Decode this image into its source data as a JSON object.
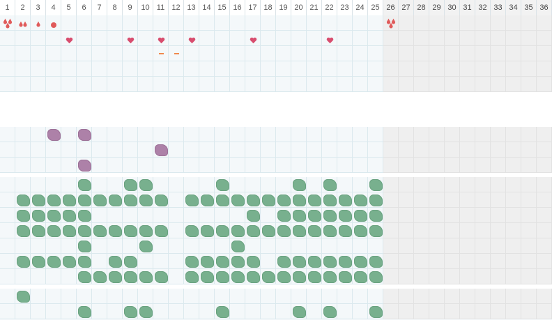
{
  "days": [
    "1",
    "2",
    "3",
    "4",
    "5",
    "6",
    "7",
    "8",
    "9",
    "10",
    "11",
    "12",
    "13",
    "14",
    "15",
    "16",
    "17",
    "18",
    "19",
    "20",
    "21",
    "22",
    "23",
    "24",
    "25",
    "26",
    "27",
    "28",
    "29",
    "30",
    "31",
    "32",
    "33",
    "34",
    "35",
    "36"
  ],
  "today_index": 25,
  "colors": {
    "background": "#f4f8fa",
    "future_background": "#efefef",
    "grid_line": "#dbe9ee",
    "drop_red": "#e05a5a",
    "heart_pink": "#d84d6e",
    "dash_orange": "#f0884e",
    "green_symptom": "#78b08e",
    "purple_symptom": "#ad81a8"
  },
  "sections": [
    {
      "id": "period",
      "rows": [
        {
          "marks": [
            {
              "day": 1,
              "icon": "drop-heavy-icon"
            },
            {
              "day": 2,
              "icon": "drop-medium-icon"
            },
            {
              "day": 3,
              "icon": "drop-light-icon"
            },
            {
              "day": 4,
              "icon": "spotting-icon"
            },
            {
              "day": 26,
              "icon": "drop-heavy-icon"
            }
          ]
        },
        {
          "marks": [
            {
              "day": 5,
              "icon": "heart-icon"
            },
            {
              "day": 9,
              "icon": "heart-icon"
            },
            {
              "day": 11,
              "icon": "heart-icon"
            },
            {
              "day": 13,
              "icon": "heart-icon"
            },
            {
              "day": 17,
              "icon": "heart-icon"
            },
            {
              "day": 22,
              "icon": "heart-icon"
            }
          ]
        },
        {
          "marks": [
            {
              "day": 11,
              "icon": "dash-icon"
            },
            {
              "day": 12,
              "icon": "dash-icon"
            }
          ]
        },
        {
          "marks": []
        },
        {
          "marks": []
        }
      ]
    },
    {
      "id": "purple",
      "rows": [
        {
          "marks": [
            {
              "day": 4,
              "icon": "purple-symptom-icon"
            },
            {
              "day": 6,
              "icon": "purple-symptom-icon"
            }
          ]
        },
        {
          "marks": [
            {
              "day": 11,
              "icon": "purple-symptom-icon"
            }
          ]
        },
        {
          "marks": [
            {
              "day": 6,
              "icon": "purple-symptom-icon"
            }
          ]
        }
      ]
    },
    {
      "id": "green",
      "rows": [
        {
          "marks": [
            {
              "day": 6,
              "icon": "green-symptom-icon"
            },
            {
              "day": 9,
              "icon": "green-symptom-icon"
            },
            {
              "day": 10,
              "icon": "green-symptom-icon"
            },
            {
              "day": 15,
              "icon": "green-symptom-icon"
            },
            {
              "day": 20,
              "icon": "green-symptom-icon"
            },
            {
              "day": 22,
              "icon": "green-symptom-icon"
            },
            {
              "day": 25,
              "icon": "green-symptom-icon"
            }
          ]
        },
        {
          "marks": [
            {
              "day": 2,
              "icon": "green-symptom-icon"
            },
            {
              "day": 3,
              "icon": "green-symptom-icon"
            },
            {
              "day": 4,
              "icon": "green-symptom-icon"
            },
            {
              "day": 5,
              "icon": "green-symptom-icon"
            },
            {
              "day": 6,
              "icon": "green-symptom-icon"
            },
            {
              "day": 7,
              "icon": "green-symptom-icon"
            },
            {
              "day": 8,
              "icon": "green-symptom-icon"
            },
            {
              "day": 9,
              "icon": "green-symptom-icon"
            },
            {
              "day": 10,
              "icon": "green-symptom-icon"
            },
            {
              "day": 11,
              "icon": "green-symptom-icon"
            },
            {
              "day": 13,
              "icon": "green-symptom-icon"
            },
            {
              "day": 14,
              "icon": "green-symptom-icon"
            },
            {
              "day": 15,
              "icon": "green-symptom-icon"
            },
            {
              "day": 16,
              "icon": "green-symptom-icon"
            },
            {
              "day": 17,
              "icon": "green-symptom-icon"
            },
            {
              "day": 18,
              "icon": "green-symptom-icon"
            },
            {
              "day": 19,
              "icon": "green-symptom-icon"
            },
            {
              "day": 20,
              "icon": "green-symptom-icon"
            },
            {
              "day": 21,
              "icon": "green-symptom-icon"
            },
            {
              "day": 22,
              "icon": "green-symptom-icon"
            },
            {
              "day": 23,
              "icon": "green-symptom-icon"
            },
            {
              "day": 24,
              "icon": "green-symptom-icon"
            },
            {
              "day": 25,
              "icon": "green-symptom-icon"
            }
          ]
        },
        {
          "marks": [
            {
              "day": 2,
              "icon": "green-symptom-icon"
            },
            {
              "day": 3,
              "icon": "green-symptom-icon"
            },
            {
              "day": 4,
              "icon": "green-symptom-icon"
            },
            {
              "day": 5,
              "icon": "green-symptom-icon"
            },
            {
              "day": 6,
              "icon": "green-symptom-icon"
            },
            {
              "day": 17,
              "icon": "green-symptom-icon"
            },
            {
              "day": 19,
              "icon": "green-symptom-icon"
            },
            {
              "day": 20,
              "icon": "green-symptom-icon"
            },
            {
              "day": 21,
              "icon": "green-symptom-icon"
            },
            {
              "day": 22,
              "icon": "green-symptom-icon"
            },
            {
              "day": 23,
              "icon": "green-symptom-icon"
            },
            {
              "day": 24,
              "icon": "green-symptom-icon"
            },
            {
              "day": 25,
              "icon": "green-symptom-icon"
            }
          ]
        },
        {
          "marks": [
            {
              "day": 2,
              "icon": "green-symptom-icon"
            },
            {
              "day": 3,
              "icon": "green-symptom-icon"
            },
            {
              "day": 4,
              "icon": "green-symptom-icon"
            },
            {
              "day": 5,
              "icon": "green-symptom-icon"
            },
            {
              "day": 6,
              "icon": "green-symptom-icon"
            },
            {
              "day": 7,
              "icon": "green-symptom-icon"
            },
            {
              "day": 8,
              "icon": "green-symptom-icon"
            },
            {
              "day": 9,
              "icon": "green-symptom-icon"
            },
            {
              "day": 10,
              "icon": "green-symptom-icon"
            },
            {
              "day": 11,
              "icon": "green-symptom-icon"
            },
            {
              "day": 13,
              "icon": "green-symptom-icon"
            },
            {
              "day": 14,
              "icon": "green-symptom-icon"
            },
            {
              "day": 15,
              "icon": "green-symptom-icon"
            },
            {
              "day": 16,
              "icon": "green-symptom-icon"
            },
            {
              "day": 17,
              "icon": "green-symptom-icon"
            },
            {
              "day": 18,
              "icon": "green-symptom-icon"
            },
            {
              "day": 19,
              "icon": "green-symptom-icon"
            },
            {
              "day": 20,
              "icon": "green-symptom-icon"
            },
            {
              "day": 21,
              "icon": "green-symptom-icon"
            },
            {
              "day": 22,
              "icon": "green-symptom-icon"
            },
            {
              "day": 23,
              "icon": "green-symptom-icon"
            },
            {
              "day": 24,
              "icon": "green-symptom-icon"
            },
            {
              "day": 25,
              "icon": "green-symptom-icon"
            }
          ]
        },
        {
          "marks": [
            {
              "day": 6,
              "icon": "green-symptom-icon"
            },
            {
              "day": 10,
              "icon": "green-symptom-icon"
            },
            {
              "day": 16,
              "icon": "green-symptom-icon"
            }
          ]
        },
        {
          "marks": [
            {
              "day": 2,
              "icon": "green-symptom-icon"
            },
            {
              "day": 3,
              "icon": "green-symptom-icon"
            },
            {
              "day": 4,
              "icon": "green-symptom-icon"
            },
            {
              "day": 5,
              "icon": "green-symptom-icon"
            },
            {
              "day": 6,
              "icon": "green-symptom-icon"
            },
            {
              "day": 8,
              "icon": "green-symptom-icon"
            },
            {
              "day": 9,
              "icon": "green-symptom-icon"
            },
            {
              "day": 13,
              "icon": "green-symptom-icon"
            },
            {
              "day": 14,
              "icon": "green-symptom-icon"
            },
            {
              "day": 15,
              "icon": "green-symptom-icon"
            },
            {
              "day": 16,
              "icon": "green-symptom-icon"
            },
            {
              "day": 17,
              "icon": "green-symptom-icon"
            },
            {
              "day": 19,
              "icon": "green-symptom-icon"
            },
            {
              "day": 20,
              "icon": "green-symptom-icon"
            },
            {
              "day": 21,
              "icon": "green-symptom-icon"
            },
            {
              "day": 22,
              "icon": "green-symptom-icon"
            },
            {
              "day": 23,
              "icon": "green-symptom-icon"
            },
            {
              "day": 24,
              "icon": "green-symptom-icon"
            },
            {
              "day": 25,
              "icon": "green-symptom-icon"
            }
          ]
        },
        {
          "marks": [
            {
              "day": 6,
              "icon": "green-symptom-icon"
            },
            {
              "day": 7,
              "icon": "green-symptom-icon"
            },
            {
              "day": 8,
              "icon": "green-symptom-icon"
            },
            {
              "day": 9,
              "icon": "green-symptom-icon"
            },
            {
              "day": 10,
              "icon": "green-symptom-icon"
            },
            {
              "day": 11,
              "icon": "green-symptom-icon"
            },
            {
              "day": 13,
              "icon": "green-symptom-icon"
            },
            {
              "day": 14,
              "icon": "green-symptom-icon"
            },
            {
              "day": 15,
              "icon": "green-symptom-icon"
            },
            {
              "day": 16,
              "icon": "green-symptom-icon"
            },
            {
              "day": 17,
              "icon": "green-symptom-icon"
            },
            {
              "day": 18,
              "icon": "green-symptom-icon"
            },
            {
              "day": 19,
              "icon": "green-symptom-icon"
            },
            {
              "day": 20,
              "icon": "green-symptom-icon"
            },
            {
              "day": 21,
              "icon": "green-symptom-icon"
            },
            {
              "day": 22,
              "icon": "green-symptom-icon"
            },
            {
              "day": 23,
              "icon": "green-symptom-icon"
            },
            {
              "day": 24,
              "icon": "green-symptom-icon"
            },
            {
              "day": 25,
              "icon": "green-symptom-icon"
            }
          ]
        }
      ]
    },
    {
      "id": "green-bottom",
      "rows": [
        {
          "marks": [
            {
              "day": 2,
              "icon": "green-symptom-icon"
            }
          ]
        },
        {
          "marks": [
            {
              "day": 6,
              "icon": "green-symptom-icon"
            },
            {
              "day": 9,
              "icon": "green-symptom-icon"
            },
            {
              "day": 10,
              "icon": "green-symptom-icon"
            },
            {
              "day": 15,
              "icon": "green-symptom-icon"
            },
            {
              "day": 20,
              "icon": "green-symptom-icon"
            },
            {
              "day": 22,
              "icon": "green-symptom-icon"
            },
            {
              "day": 25,
              "icon": "green-symptom-icon"
            }
          ]
        }
      ]
    }
  ]
}
